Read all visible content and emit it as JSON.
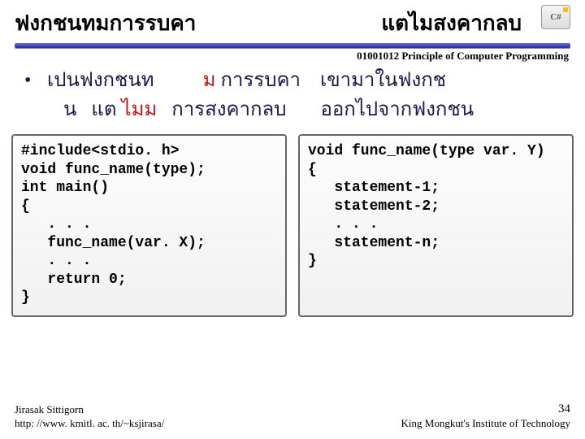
{
  "header": {
    "title_left": "ฟงกชนทมการรบคา",
    "title_right": "แตไมสงคากลบ",
    "badge": "C#"
  },
  "course": "01001012 Principle of Computer Programming",
  "body": {
    "bullet": "•",
    "line1_a": "เปนฟงกชนท",
    "line1_b": "ม",
    "line1_c": " การรบคา",
    "line1_d": "    เขามาในฟงกช",
    "line2_a": "น   แต ",
    "line2_b": "ไมม",
    "line2_c": "   การสงคากลบ",
    "line2_d": "       ออกไปจากฟงกชน"
  },
  "code_left": "#include<stdio. h>\nvoid func_name(type);\nint main()\n{\n   . . .\n   func_name(var. X);\n   . . .\n   return 0;\n}",
  "code_right": "void func_name(type var. Y)\n{\n   statement-1;\n   statement-2;\n   . . .\n   statement-n;\n}",
  "footer": {
    "author": "Jirasak Sittigorn",
    "url": "http: //www. kmitl. ac. th/~ksjirasa/",
    "page": "34",
    "org": "King Mongkut's Institute of Technology"
  }
}
